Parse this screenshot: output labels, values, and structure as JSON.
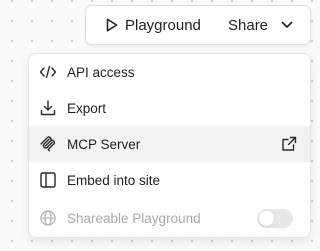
{
  "topbar": {
    "playground_label": "Playground",
    "playground_icon": "play-icon",
    "share_label": "Share",
    "share_icon": "chevron-down-icon"
  },
  "menu": {
    "items": [
      {
        "label": "API access",
        "icon": "code-icon"
      },
      {
        "label": "Export",
        "icon": "download-icon"
      },
      {
        "label": "MCP Server",
        "icon": "mcp-icon",
        "trailing_icon": "external-link-icon",
        "highlighted": true
      },
      {
        "label": "Embed into site",
        "icon": "embed-panel-icon"
      },
      {
        "label": "Shareable Playground",
        "icon": "globe-icon",
        "disabled": true,
        "toggle_on": false
      }
    ]
  },
  "colors": {
    "text": "#1f1f1f",
    "disabled_text": "#a8a8a8",
    "highlight_bg": "#f2f2f2",
    "toggle_off": "#e7e7e7"
  }
}
